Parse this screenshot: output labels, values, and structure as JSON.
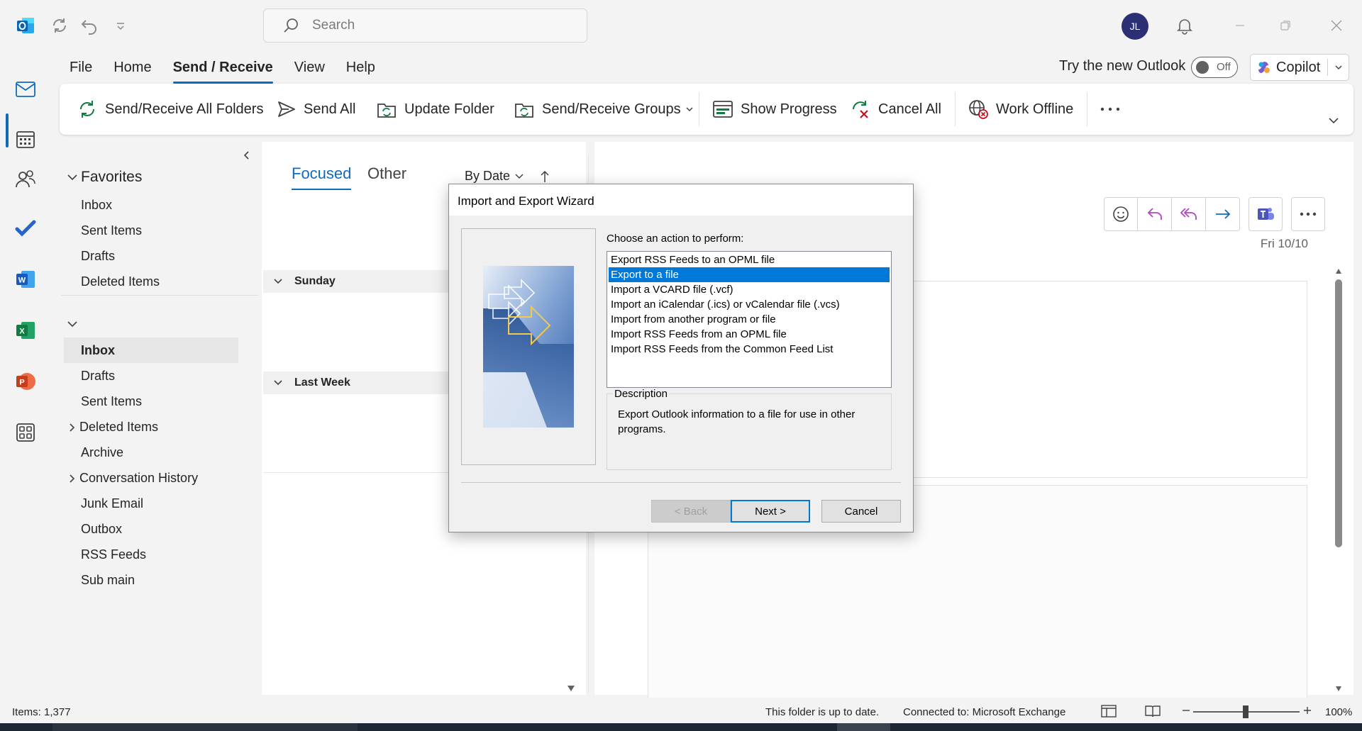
{
  "titlebar": {
    "search_placeholder": "Search",
    "avatar_initials": "JL"
  },
  "menu": {
    "tabs": [
      "File",
      "Home",
      "Send / Receive",
      "View",
      "Help"
    ],
    "active": "Send / Receive",
    "try_new_outlook": "Try the new Outlook",
    "toggle_label": "Off",
    "copilot_label": "Copilot"
  },
  "ribbon": {
    "send_receive_all": "Send/Receive All Folders",
    "send_all": "Send All",
    "update_folder": "Update Folder",
    "send_receive_groups": "Send/Receive Groups",
    "show_progress": "Show Progress",
    "cancel_all": "Cancel All",
    "work_offline": "Work Offline"
  },
  "folders": {
    "favorites_label": "Favorites",
    "favorites": [
      "Inbox",
      "Sent Items",
      "Drafts",
      "Deleted Items"
    ],
    "account": {
      "inbox": "Inbox",
      "drafts": "Drafts",
      "sent_items": "Sent Items",
      "deleted_items": "Deleted Items",
      "archive": "Archive",
      "conversation_history": "Conversation History",
      "junk_email": "Junk Email",
      "outbox": "Outbox",
      "rss_feeds": "RSS Feeds",
      "sub_main": "Sub main"
    }
  },
  "message_list": {
    "tab_focused": "Focused",
    "tab_other": "Other",
    "sort": "By Date",
    "group_sunday": "Sunday",
    "group_last_week": "Last Week"
  },
  "reading_pane": {
    "date": "Fri 10/10"
  },
  "dialog": {
    "title": "Import and Export Wizard",
    "prompt": "Choose an action to perform:",
    "options": [
      "Export RSS Feeds to an OPML file",
      "Export to a file",
      "Import a VCARD file (.vcf)",
      "Import an iCalendar (.ics) or vCalendar file (.vcs)",
      "Import from another program or file",
      "Import RSS Feeds from an OPML file",
      "Import RSS Feeds from the Common Feed List"
    ],
    "selected_index": 1,
    "description_caption": "Description",
    "description_text": "Export Outlook information to a file for use in other programs.",
    "back_label": "< Back",
    "next_label": "Next >",
    "cancel_label": "Cancel"
  },
  "statusbar": {
    "items": "Items: 1,377",
    "folder_status": "This folder is up to date.",
    "connection": "Connected to: Microsoft Exchange",
    "zoom": "100%"
  },
  "colors": {
    "accent": "#0f6cbd",
    "selection": "#0078d7",
    "avatar_bg": "#2b2f73"
  }
}
